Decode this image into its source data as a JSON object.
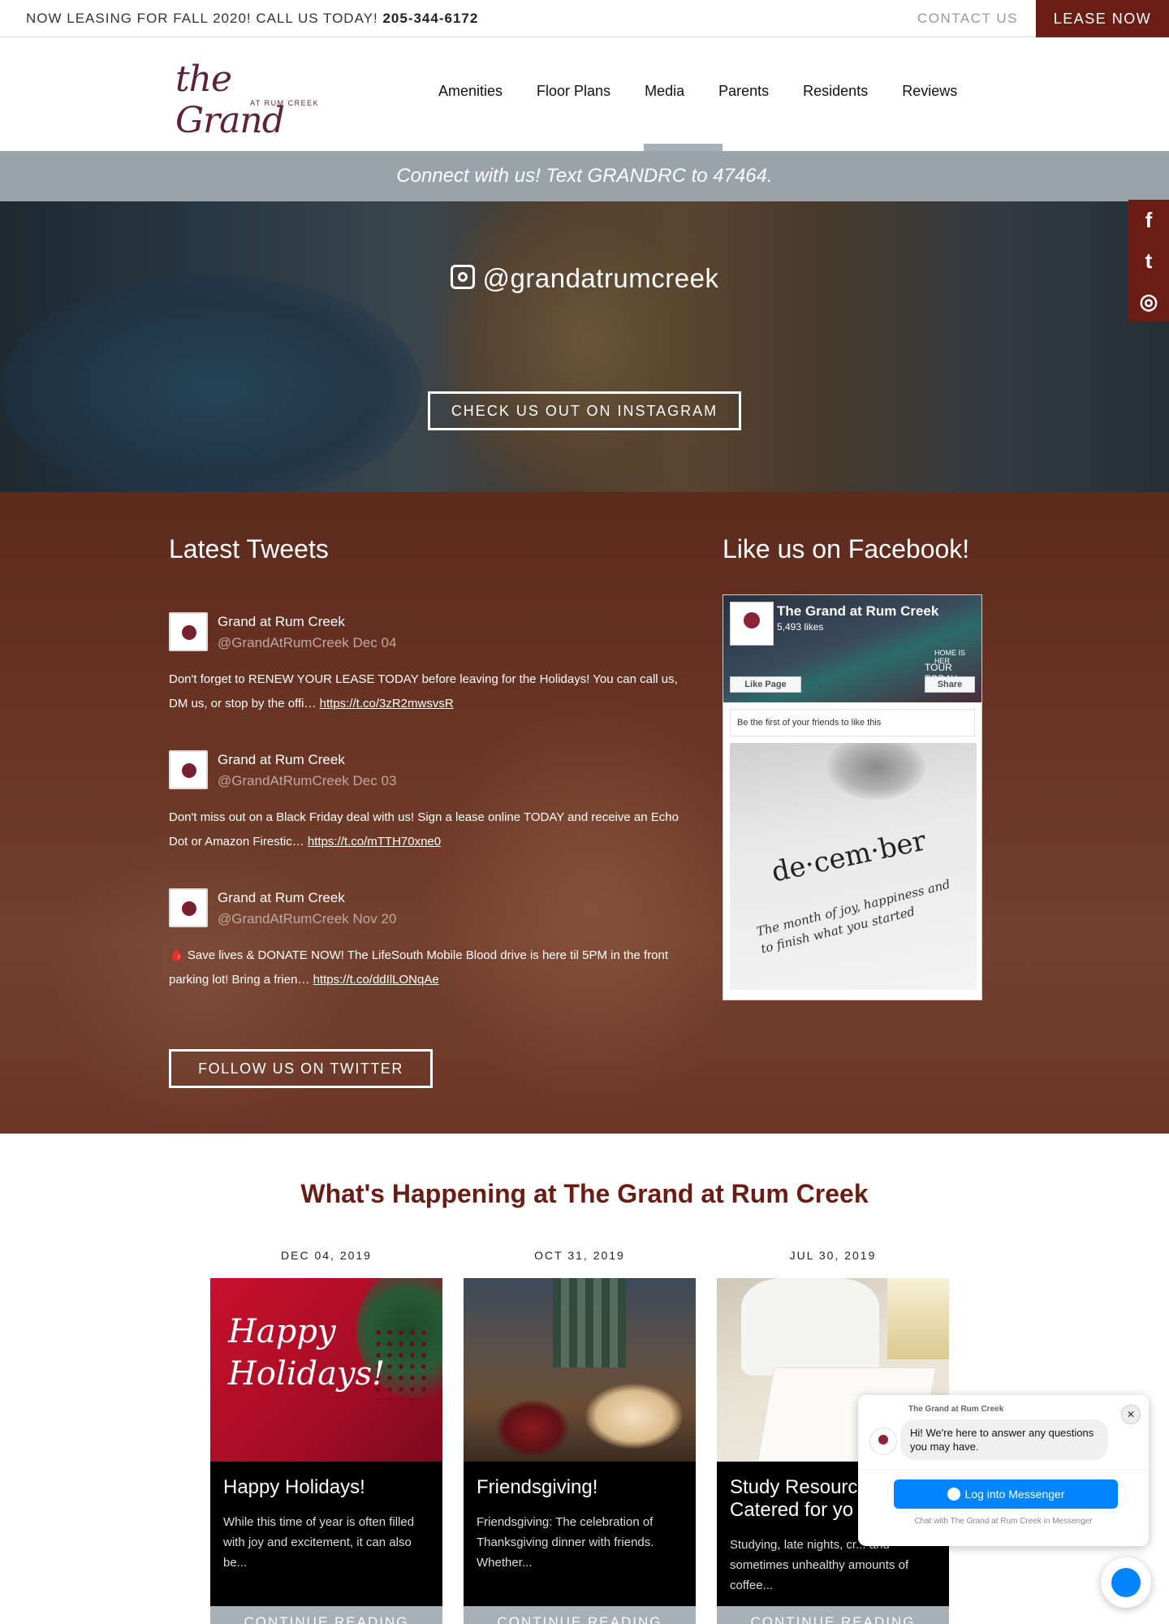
{
  "topbar": {
    "leasing_msg": "NOW LEASING FOR FALL 2020! CALL US TODAY!",
    "phone": "205-344-6172",
    "contact_label": "CONTACT US",
    "lease_label": "LEASE NOW",
    "accent": "#6b1d14"
  },
  "logo": {
    "main": "the Grand",
    "sub": "AT RUM CREEK"
  },
  "nav": {
    "items": [
      "Amenities",
      "Floor Plans",
      "Media",
      "Parents",
      "Residents",
      "Reviews"
    ],
    "active": "Media"
  },
  "connect_banner": "Connect with us! Text GRANDRC to 47464.",
  "social_tabs": [
    {
      "icon": "facebook-icon",
      "glyph": "f"
    },
    {
      "icon": "twitter-icon",
      "glyph": "t"
    },
    {
      "icon": "instagram-icon",
      "glyph": "◎"
    }
  ],
  "instagram": {
    "handle": "@grandatrumcreek",
    "button": "CHECK US OUT ON INSTAGRAM"
  },
  "tweets": {
    "heading": "Latest Tweets",
    "items": [
      {
        "name": "Grand at Rum Creek",
        "handle": "@GrandAtRumCreek Dec 04",
        "text": "Don't forget to RENEW YOUR LEASE TODAY before leaving for the Holidays! You can call us, DM us, or stop by the offi…",
        "link": "https://t.co/3zR2mwsvsR"
      },
      {
        "name": "Grand at Rum Creek",
        "handle": "@GrandAtRumCreek Dec 03",
        "text": "Don't miss out on a Black Friday deal with us! Sign a lease online TODAY and receive an Echo Dot or Amazon Firestic…",
        "link": "https://t.co/mTTH70xne0"
      },
      {
        "name": "Grand at Rum Creek",
        "handle": "@GrandAtRumCreek Nov 20",
        "text": "🩸 Save lives & DONATE NOW! The LifeSouth Mobile Blood drive is here til 5PM in the front parking lot! Bring a frien…",
        "link": "https://t.co/ddIlLONqAe"
      }
    ],
    "follow_button": "FOLLOW US ON TWITTER"
  },
  "facebook": {
    "heading": "Like us on Facebook!",
    "page_name": "The Grand at Rum Creek",
    "likes": "5,493 likes",
    "home_text": "HOME IS HER",
    "tour_text": "TOUR TODAY",
    "like_button": "Like Page",
    "share_button": "Share",
    "friends_text": "Be the first of your friends to like this",
    "post_word": "de·cem·ber",
    "post_text": "The month of joy, happiness and to finish what you started"
  },
  "happening": {
    "title": "What's Happening at The Grand at Rum Creek",
    "cards": [
      {
        "date": "DEC 04, 2019",
        "title": "Happy Holidays!",
        "excerpt": "While this time of year is often filled with joy and excitement, it can also be...",
        "image_text": "Happy Holidays!",
        "more": "CONTINUE READING"
      },
      {
        "date": "OCT 31, 2019",
        "title": "Friendsgiving!",
        "excerpt": "Friendsgiving: The celebration of Thanksgiving dinner with friends. Whether...",
        "more": "CONTINUE READING"
      },
      {
        "date": "JUL 30, 2019",
        "title": "Study Resources Catered for yo",
        "excerpt": "Studying, late nights, cr... and sometimes unhealthy amounts of coffee...",
        "more": "CONTINUE READING"
      }
    ]
  },
  "messenger": {
    "page_name": "The Grand at Rum Creek",
    "greeting": "Hi! We're here to answer any questions you may have.",
    "login_button": "Log into Messenger",
    "chat_with": "Chat with The Grand at Rum Creek in Messenger",
    "close_glyph": "✕",
    "brand_color": "#0084ff"
  }
}
